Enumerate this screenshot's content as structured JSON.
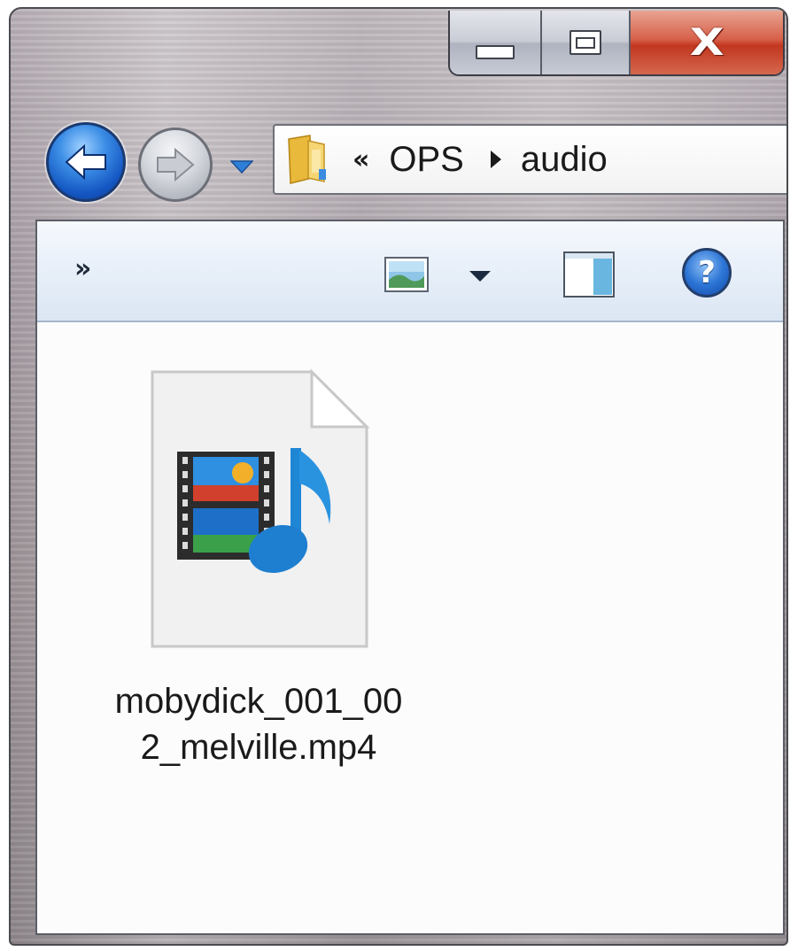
{
  "window": {
    "caption_buttons": {
      "minimize_icon": "minimize-icon",
      "maximize_icon": "maximize-icon",
      "close_label": "X"
    }
  },
  "navigation": {
    "back_icon": "back-arrow-icon",
    "forward_icon": "forward-arrow-icon",
    "recent_icon": "dropdown-arrow-icon"
  },
  "address_bar": {
    "overflow_label": "«",
    "breadcrumbs": [
      {
        "label": "OPS"
      },
      {
        "label": "audio"
      }
    ]
  },
  "toolbar": {
    "overflow_label": "»",
    "views_icon": "change-view-icon",
    "preview_pane_icon": "preview-pane-icon",
    "help_label": "?"
  },
  "files": [
    {
      "name": "mobydick_001_002_melville.mp4",
      "name_line1": "mobydick_001_00",
      "name_line2": "2_melville.mp4",
      "icon": "video-audio-file-icon"
    }
  ],
  "colors": {
    "accent": "#1456c2",
    "close": "#c2371f"
  }
}
